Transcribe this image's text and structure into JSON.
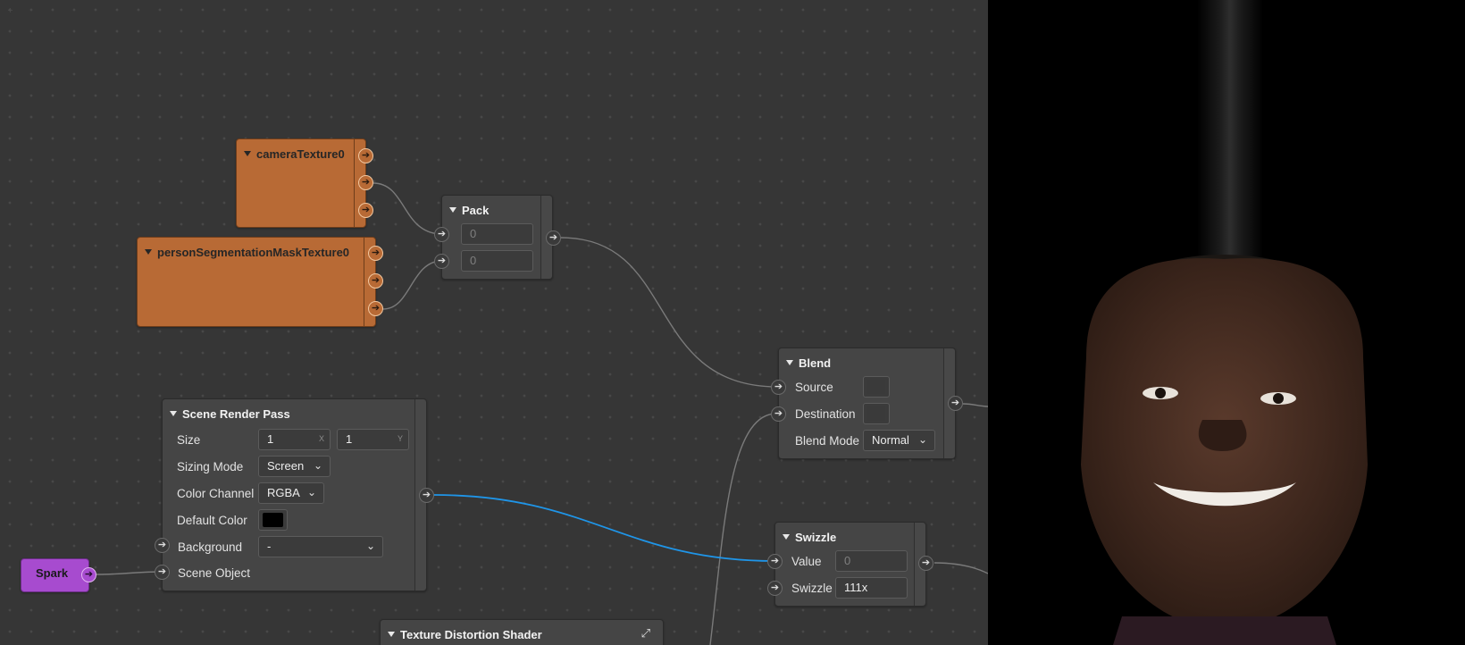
{
  "nodes": {
    "camera_texture": {
      "title": "cameraTexture0",
      "outputs": [
        "output",
        "output",
        "output"
      ]
    },
    "person_seg": {
      "title": "personSegmentationMaskTexture0",
      "outputs": [
        "output",
        "output",
        "output"
      ]
    },
    "pack": {
      "title": "Pack",
      "input1_value": "0",
      "input2_value": "0"
    },
    "blend": {
      "title": "Blend",
      "source_label": "Source",
      "destination_label": "Destination",
      "blend_mode_label": "Blend Mode",
      "blend_mode_value": "Normal",
      "source_color": "#3a3a3a",
      "destination_color": "#3a3a3a"
    },
    "scene_render_pass": {
      "title": "Scene Render Pass",
      "size_label": "Size",
      "size_x": "1",
      "size_x_axis": "X",
      "size_y": "1",
      "size_y_axis": "Y",
      "sizing_mode_label": "Sizing Mode",
      "sizing_mode_value": "Screen",
      "color_channel_label": "Color Channel",
      "color_channel_value": "RGBA",
      "default_color_label": "Default Color",
      "default_color": "#000000",
      "background_label": "Background",
      "background_value": "-",
      "scene_object_label": "Scene Object"
    },
    "spark": {
      "title": "Spark"
    },
    "swizzle": {
      "title": "Swizzle",
      "value_label": "Value",
      "value_field": "0",
      "swizzle_label": "Swizzle",
      "swizzle_field": "111x"
    },
    "texture_distortion": {
      "title": "Texture Distortion Shader"
    }
  },
  "colors": {
    "canvas_bg": "#363636",
    "node_bg": "#454545",
    "texture_node": "#b86a35",
    "spark_node": "#a74bcf",
    "active_wire": "#1f95e8",
    "wire": "#7a7a7a"
  },
  "icons": {
    "port": "arrow-right-icon",
    "expand": "expand-icon",
    "collapse": "triangle-down-icon",
    "dropdown": "chevron-down-icon"
  }
}
